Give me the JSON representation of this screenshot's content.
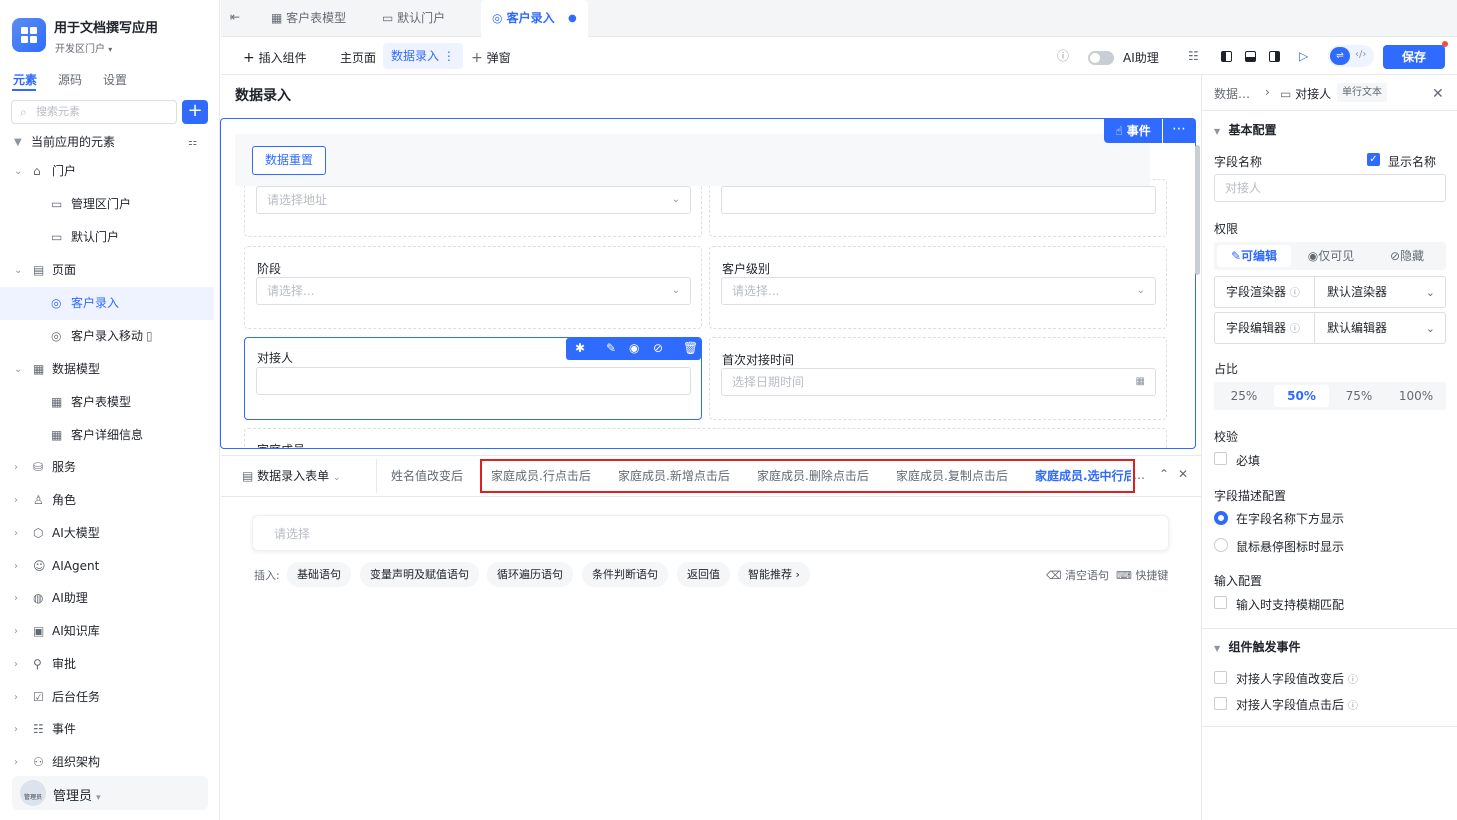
{
  "app": {
    "name": "用于文档撰写应用",
    "portal": "开发区门户"
  },
  "sidebar": {
    "tabs": [
      "元素",
      "源码",
      "设置"
    ],
    "search_placeholder": "搜索元素",
    "section_title": "当前应用的元素",
    "items": [
      {
        "label": "门户",
        "icon": "home-icon"
      },
      {
        "label": "管理区门户",
        "icon": "portal-icon"
      },
      {
        "label": "默认门户",
        "icon": "portal-icon"
      },
      {
        "label": "页面",
        "icon": "page-icon"
      },
      {
        "label": "客户录入",
        "icon": "page-link-icon"
      },
      {
        "label": "客户录入移动",
        "icon": "page-link-icon"
      },
      {
        "label": "数据模型",
        "icon": "table-icon"
      },
      {
        "label": "客户表模型",
        "icon": "table-icon"
      },
      {
        "label": "客户详细信息",
        "icon": "table-icon"
      },
      {
        "label": "服务",
        "icon": "service-icon"
      },
      {
        "label": "角色",
        "icon": "role-icon"
      },
      {
        "label": "AI大模型",
        "icon": "ai-model-icon"
      },
      {
        "label": "AIAgent",
        "icon": "robot-icon"
      },
      {
        "label": "AI助理",
        "icon": "ai-assistant-icon"
      },
      {
        "label": "AI知识库",
        "icon": "knowledge-icon"
      },
      {
        "label": "审批",
        "icon": "approve-icon"
      },
      {
        "label": "后台任务",
        "icon": "task-icon"
      },
      {
        "label": "事件",
        "icon": "event-icon"
      },
      {
        "label": "组织架构",
        "icon": "org-icon"
      }
    ],
    "user": {
      "name": "管理员",
      "avatar_text": "管理员"
    }
  },
  "top_tabs": [
    "客户表模型",
    "默认门户",
    "客户录入"
  ],
  "toolbar": {
    "insert": "插入组件",
    "main_page": "主页面",
    "data_input": "数据录入",
    "popup": "弹窗",
    "ai_assistant": "AI助理",
    "save": "保存"
  },
  "canvas": {
    "page_title": "数据录入",
    "event_btn": "事件",
    "reset_btn": "数据重置",
    "fields": {
      "addr_placeholder": "请选择地址",
      "stage_label": "阶段",
      "stage_placeholder": "请选择...",
      "level_label": "客户级别",
      "level_placeholder": "请选择...",
      "contact_label": "对接人",
      "first_time_label": "首次对接时间",
      "first_time_placeholder": "选择日期时间",
      "family_label": "家庭成员"
    }
  },
  "bottom": {
    "form_tab": "数据录入表单",
    "event_tabs": [
      "姓名值改变后",
      "家庭成员.行点击后",
      "家庭成员.新增点击后",
      "家庭成员.删除点击后",
      "家庭成员.复制点击后",
      "家庭成员.选中行后"
    ],
    "select_placeholder": "请选择",
    "insert_label": "插入:",
    "chips": [
      "基础语句",
      "变量声明及赋值语句",
      "循环遍历语句",
      "条件判断语句",
      "返回值",
      "智能推荐"
    ],
    "clear": "清空语句",
    "shortcut": "快捷键"
  },
  "right": {
    "breadcrumb_parent": "数据…",
    "breadcrumb_current": "对接人",
    "type_badge": "单行文本",
    "basic_config": "基本配置",
    "field_name_label": "字段名称",
    "show_name": "显示名称",
    "field_name_value": "对接人",
    "perm_label": "权限",
    "perm_options": [
      "可编辑",
      "仅可见",
      "隐藏"
    ],
    "renderer_label": "字段渲染器",
    "renderer_value": "默认渲染器",
    "editor_label": "字段编辑器",
    "editor_value": "默认编辑器",
    "ratio_label": "占比",
    "ratio_options": [
      "25%",
      "50%",
      "75%",
      "100%"
    ],
    "validate_label": "校验",
    "required": "必填",
    "desc_label": "字段描述配置",
    "desc_opt1": "在字段名称下方显示",
    "desc_opt2": "鼠标悬停图标时显示",
    "input_label": "输入配置",
    "fuzzy": "输入时支持模糊匹配",
    "trigger_label": "组件触发事件",
    "trigger1": "对接人字段值改变后",
    "trigger2": "对接人字段值点击后"
  }
}
